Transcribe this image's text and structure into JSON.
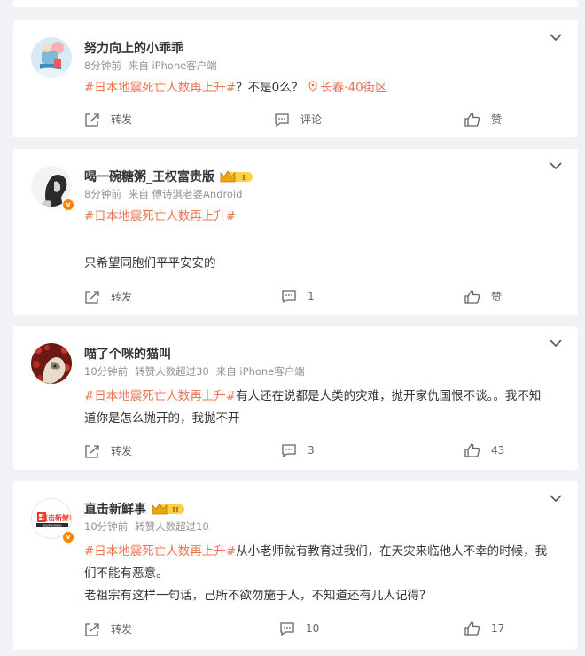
{
  "feed": {
    "posts": [
      {
        "user": "努力向上的小乖乖",
        "time": "8分钟前",
        "source": "来自 iPhone客户端",
        "hashtag": "#日本地震死亡人数再上升#",
        "text": "？不是0么？",
        "location": "长春·40街区",
        "repost_label": "转发",
        "comment_label": "评论",
        "like_label": "赞"
      },
      {
        "user": "喝一碗糖粥_王权富贵版",
        "time": "8分钟前",
        "source": "来自 傅诗淇老婆Android",
        "hashtag": "#日本地震死亡人数再上升#",
        "text": "只希望同胞们平平安安的",
        "repost_label": "转发",
        "comment_count": "1",
        "like_label": "赞",
        "badge": "I"
      },
      {
        "user": "喵了个咪的猫叫",
        "time": "10分钟前",
        "reposts": "转赞人数超过30",
        "source": "来自 iPhone客户端",
        "hashtag": "#日本地震死亡人数再上升#",
        "text_line1": "有人还在说都是人类的灾难，抛开家仇国恨不谈。。我不知",
        "text_line2": "道你是怎么抛开的，我抛不开",
        "repost_label": "转发",
        "comment_count": "3",
        "like_count": "43"
      },
      {
        "user": "直击新鲜事",
        "time": "10分钟前",
        "reposts": "转赞人数超过10",
        "hashtag": "#日本地震死亡人数再上升#",
        "text_line1": "从小老师就有教育过我们，在天灾来临他人不幸的时候，我",
        "text_line2": "们不能有恶意。",
        "text_line3": "老祖宗有这样一句话，己所不欲勿施于人，不知道还有几人记得？",
        "repost_label": "转发",
        "comment_count": "10",
        "like_count": "17",
        "badge": "II",
        "avatar_text": "直击新鲜事",
        "avatar_sub": "ZHIJIXINXIANSHI"
      }
    ]
  },
  "colors": {
    "accent": "#eb7350",
    "background": "#f1f2f5",
    "text": "#333333",
    "meta": "#939393",
    "verified": "#ff8200"
  },
  "icons": {
    "collapse": "chevron-down-icon",
    "repost": "share-arrow-icon",
    "comment": "comment-bubble-icon",
    "like": "thumbs-up-icon",
    "location": "location-pin-icon",
    "member": "crown-badge-icon"
  }
}
